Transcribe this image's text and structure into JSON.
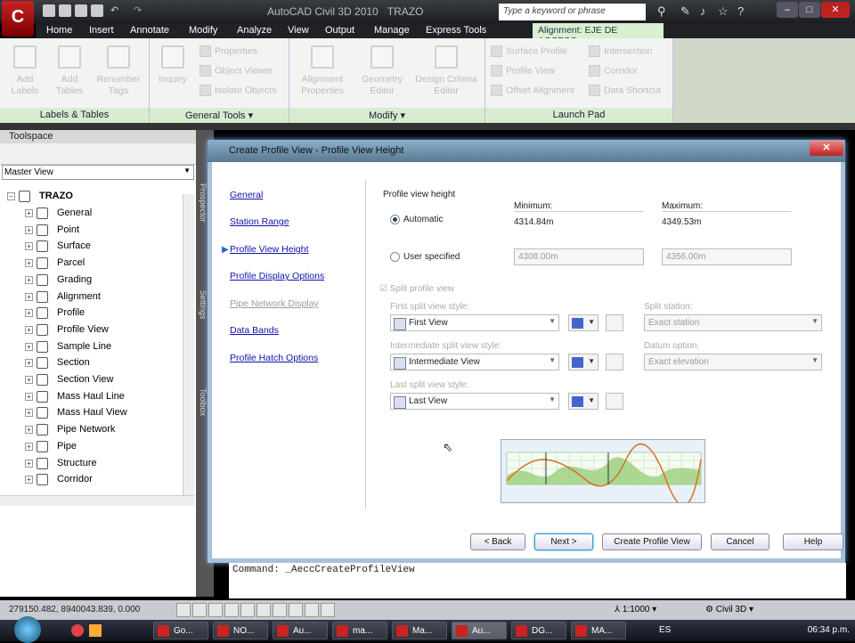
{
  "app": {
    "title": "AutoCAD Civil 3D 2010",
    "drawing": "TRAZO",
    "search_placeholder": "Type a keyword or phrase"
  },
  "tabs": [
    "Home",
    "Insert",
    "Annotate",
    "Modify",
    "Analyze",
    "View",
    "Output",
    "Manage",
    "Express Tools"
  ],
  "active_tab": "Alignment: EJE DE ACCESO",
  "ribbon": {
    "labels_tables": {
      "title": "Labels & Tables",
      "add_labels": "Add Labels",
      "add_tables": "Add Tables",
      "renumber_tags": "Renumber Tags"
    },
    "general_tools": {
      "title": "General Tools ▾",
      "inquiry": "Inquiry",
      "properties": "Properties",
      "object_viewer": "Object Viewer",
      "isolate_objects": "Isolate Objects"
    },
    "modify": {
      "title": "Modify ▾",
      "alignment_properties": "Alignment Properties",
      "geometry_editor": "Geometry Editor",
      "design_criteria_editor": "Design Criteria Editor"
    },
    "launch_pad": {
      "title": "Launch Pad",
      "surface_profile": "Surface Profile",
      "profile_view": "Profile View",
      "offset_alignment": "Offset Alignment",
      "intersection": "Intersection",
      "corridor": "Corridor",
      "data_shortcut": "Data Shortcut"
    }
  },
  "toolspace": {
    "title": "Toolspace",
    "view": "Master View",
    "root": "TRAZO",
    "items": [
      "General",
      "Point",
      "Surface",
      "Parcel",
      "Grading",
      "Alignment",
      "Profile",
      "Profile View",
      "Sample Line",
      "Section",
      "Section View",
      "Mass Haul Line",
      "Mass Haul View",
      "Pipe Network",
      "Pipe",
      "Structure",
      "Corridor"
    ],
    "palette_tabs": [
      "Prospector",
      "Settings",
      "Toolbox"
    ]
  },
  "dialog": {
    "title": "Create Profile View - Profile View Height",
    "nav": [
      {
        "label": "General",
        "enabled": true
      },
      {
        "label": "Station Range",
        "enabled": true
      },
      {
        "label": "Profile View Height",
        "enabled": true,
        "current": true
      },
      {
        "label": "Profile Display Options",
        "enabled": true
      },
      {
        "label": "Pipe Network Display",
        "enabled": false
      },
      {
        "label": "Data Bands",
        "enabled": true
      },
      {
        "label": "Profile Hatch Options",
        "enabled": true
      }
    ],
    "section_title": "Profile view height",
    "minimum_label": "Minimum:",
    "maximum_label": "Maximum:",
    "automatic_label": "Automatic",
    "auto_min": "4314.84m",
    "auto_max": "4349.53m",
    "user_label": "User specified",
    "user_min": "4308.00m",
    "user_max": "4356.00m",
    "split_label": "Split profile view",
    "first_label": "First split view style:",
    "first_value": "First View",
    "intermediate_label": "Intermediate split view style:",
    "intermediate_value": "Intermediate View",
    "last_label": "Last split view style:",
    "last_value": "Last View",
    "split_station_label": "Split station:",
    "split_station_value": "Exact station",
    "datum_label": "Datum option:",
    "datum_value": "Exact elevation",
    "buttons": {
      "back": "< Back",
      "next": "Next >",
      "create": "Create Profile View",
      "cancel": "Cancel",
      "help": "Help"
    }
  },
  "command": "Command: _AeccCreateProfileView",
  "status": {
    "coords": "279150.482, 8940043.839, 0.000",
    "scale": "1:1000",
    "workspace": "Civil 3D"
  },
  "taskbar": {
    "tasks": [
      "Go...",
      "NO...",
      "Au...",
      "ma...",
      "Ma...",
      "Au...",
      "DG...",
      "MA..."
    ],
    "lang": "ES",
    "clock": "06:34 p.m."
  }
}
